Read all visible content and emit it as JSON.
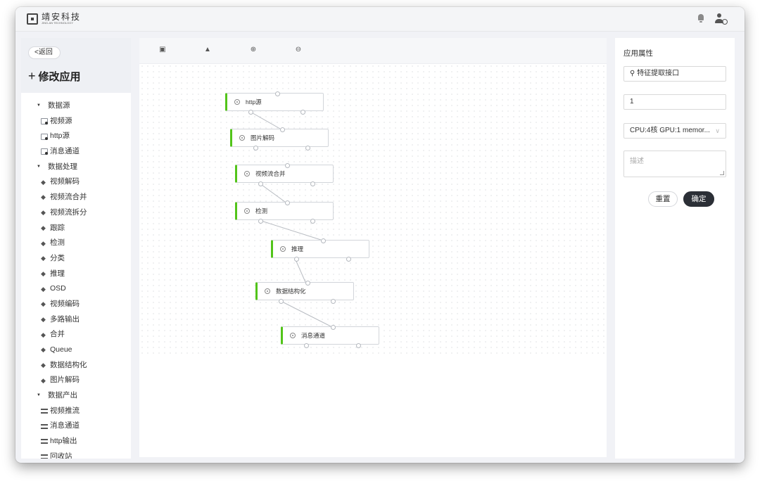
{
  "header": {
    "logo_cn": "靖安科技",
    "logo_en": "JING-AN TECHNOLOGY",
    "icons": [
      "bell-icon",
      "user-settings-icon"
    ]
  },
  "left": {
    "back_label": "返回",
    "title": "修改应用",
    "categories": [
      {
        "label": "数据源",
        "icon": "source-icon",
        "items": [
          "视频源",
          "http源",
          "消息通道"
        ]
      },
      {
        "label": "数据处理",
        "icon": "layers-icon",
        "items": [
          "视频解码",
          "视频流合并",
          "视频流拆分",
          "跟踪",
          "检测",
          "分类",
          "推理",
          "OSD",
          "视频编码",
          "多路输出",
          "合并",
          "Queue",
          "数据结构化",
          "图片解码"
        ]
      },
      {
        "label": "数据产出",
        "icon": "output-icon",
        "items": [
          "视频推流",
          "消息通道",
          "http输出",
          "回收站"
        ]
      }
    ]
  },
  "toolbar": {
    "buttons": [
      "save-icon",
      "clear-icon",
      "zoom-in-icon",
      "zoom-out-icon"
    ]
  },
  "canvas": {
    "nodes": [
      {
        "label": "http源"
      },
      {
        "label": "图片解码"
      },
      {
        "label": "视频流合并"
      },
      {
        "label": "检测"
      },
      {
        "label": "推理"
      },
      {
        "label": "数据结构化"
      },
      {
        "label": "消息通道"
      }
    ]
  },
  "right": {
    "title": "应用属性",
    "search_value": "特征提取接口",
    "count_value": "1",
    "resource_value": "CPU:4核 GPU:1 memor...",
    "desc_placeholder": "描述",
    "reset_label": "重置",
    "ok_label": "确定"
  },
  "colors": {
    "accent": "#52c41a",
    "primary_button": "#2b2f36"
  }
}
